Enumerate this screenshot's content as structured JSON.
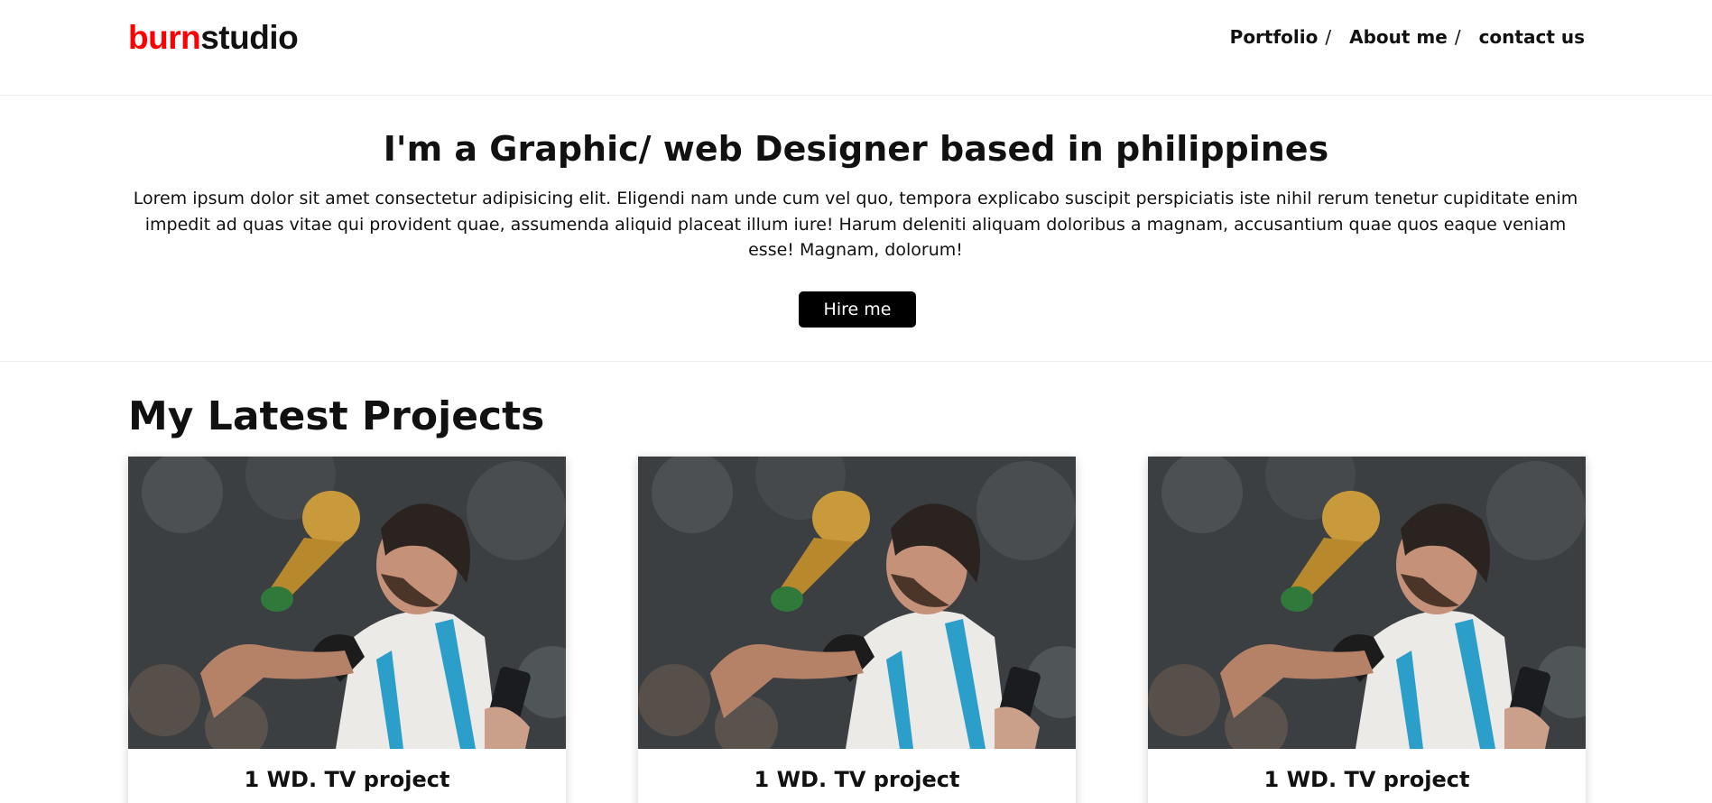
{
  "brand": {
    "part1": "burn",
    "part2": "studio"
  },
  "nav": {
    "items": [
      "Portfolio",
      "About me",
      "contact us"
    ],
    "separator": "/"
  },
  "hero": {
    "title": "I'm a Graphic/ web Designer based in philippines",
    "body": "Lorem ipsum dolor sit amet consectetur adipisicing elit. Eligendi nam unde cum vel quo, tempora explicabo suscipit perspiciatis iste nihil rerum tenetur cupiditate enim impedit ad quas vitae qui provident quae, assumenda aliquid placeat illum iure! Harum deleniti aliquam doloribus a magnam, accusantium quae quos eaque veniam esse! Magnam, dolorum!",
    "cta": "Hire me"
  },
  "projects": {
    "heading": "My Latest Projects",
    "cards": [
      {
        "title": "1 WD. TV project",
        "image": "photo-player-kissing-trophy"
      },
      {
        "title": "1 WD. TV project",
        "image": "photo-player-kissing-trophy"
      },
      {
        "title": "1 WD. TV project",
        "image": "photo-player-kissing-trophy"
      }
    ]
  },
  "colors": {
    "brand_red": "#ff0000",
    "text": "#111111",
    "button_bg": "#000000"
  }
}
